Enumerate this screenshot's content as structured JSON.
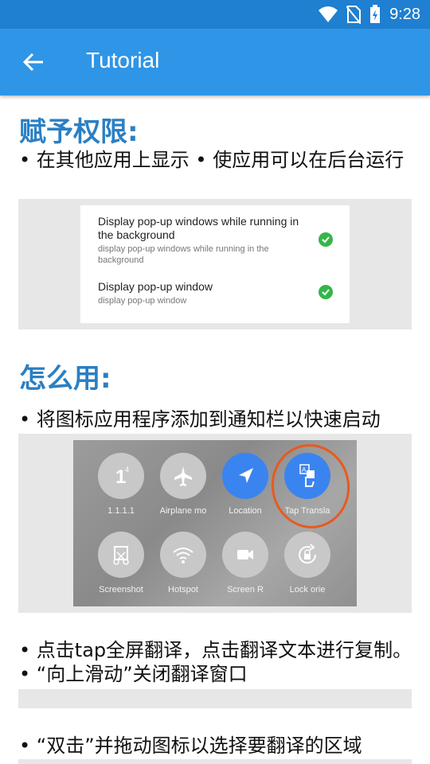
{
  "status_bar": {
    "time": "9:28"
  },
  "app_bar": {
    "title": "Tutorial"
  },
  "section1": {
    "heading": "赋予权限:",
    "text": "• 在其他应用上显示 • 使应用可以在后台运行",
    "permissions": [
      {
        "title": "Display pop-up windows while running in the background",
        "subtitle": "display pop-up windows while running in the background",
        "granted": true
      },
      {
        "title": "Display pop-up window",
        "subtitle": "display pop-up window",
        "granted": true
      }
    ]
  },
  "section2": {
    "heading": "怎么用:",
    "step1": "• 将图标应用程序添加到通知栏以快速启动",
    "quick_settings": [
      {
        "label": "1.1.1.1",
        "icon": "one-one-icon",
        "active": false
      },
      {
        "label": "Airplane mo",
        "icon": "airplane-icon",
        "active": false
      },
      {
        "label": "Location",
        "icon": "location-icon",
        "active": true
      },
      {
        "label": "Tap Transla",
        "icon": "translate-icon",
        "active": true
      },
      {
        "label": "Screenshot",
        "icon": "screenshot-icon",
        "active": false
      },
      {
        "label": "Hotspot",
        "icon": "hotspot-icon",
        "active": false
      },
      {
        "label": "Screen R",
        "icon": "screen-record-icon",
        "active": false
      },
      {
        "label": "Lock orie",
        "icon": "lock-rotation-icon",
        "active": false
      }
    ],
    "step2": "• 点击tap全屏翻译，点击翻译文本进行复制。 • “向上滑动”关闭翻译窗口",
    "step3": "• “双击”并拖动图标以选择要翻译的区域"
  },
  "colors": {
    "accent": "#2f95e6",
    "heading": "#2b7fc4",
    "check": "#35b54a",
    "highlight": "#e85a1e"
  }
}
